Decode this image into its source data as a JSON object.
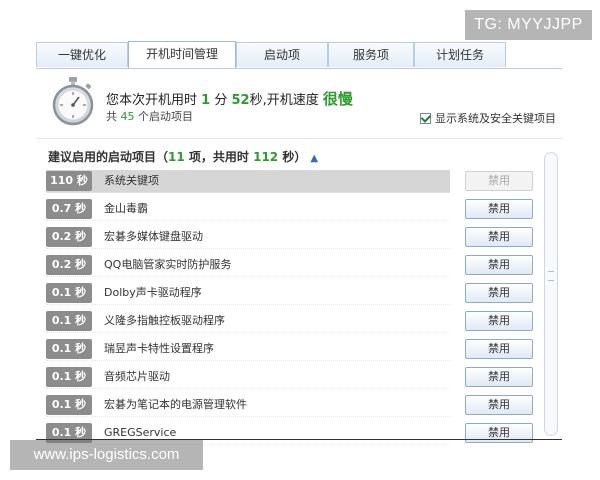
{
  "watermark_top": "TG: MYYJJPP",
  "watermark_bottom": "www.ips-logistics.com",
  "tabs": [
    {
      "label": "一键优化"
    },
    {
      "label": "开机时间管理"
    },
    {
      "label": "启动项"
    },
    {
      "label": "服务项"
    },
    {
      "label": "计划任务"
    }
  ],
  "summary": {
    "prefix": "您本次开机用时",
    "minutes": "1",
    "min_unit": "分",
    "seconds": "52",
    "sec_unit": "秒",
    "speed_label": ",开机速度",
    "speed_value": "很慢",
    "count_prefix": "共",
    "count": "45",
    "count_suffix": "个启动项目"
  },
  "show_system_checkbox": {
    "label": "显示系统及安全关键项目",
    "checked": true
  },
  "section": {
    "prefix": "建议启用的启动项目（",
    "count": "11",
    "middle": "项，共用时",
    "time": "112",
    "suffix": "秒）"
  },
  "items": [
    {
      "time": "110 秒",
      "name": "系统关键项",
      "button": "禁用",
      "disabled": true
    },
    {
      "time": "0.7 秒",
      "name": "金山毒霸",
      "button": "禁用",
      "disabled": false
    },
    {
      "time": "0.2 秒",
      "name": "宏碁多媒体键盘驱动",
      "button": "禁用",
      "disabled": false
    },
    {
      "time": "0.2 秒",
      "name": "QQ电脑管家实时防护服务",
      "button": "禁用",
      "disabled": false
    },
    {
      "time": "0.1 秒",
      "name": "Dolby声卡驱动程序",
      "button": "禁用",
      "disabled": false
    },
    {
      "time": "0.1 秒",
      "name": "义隆多指触控板驱动程序",
      "button": "禁用",
      "disabled": false
    },
    {
      "time": "0.1 秒",
      "name": "瑞昱声卡特性设置程序",
      "button": "禁用",
      "disabled": false
    },
    {
      "time": "0.1 秒",
      "name": "音频芯片驱动",
      "button": "禁用",
      "disabled": false
    },
    {
      "time": "0.1 秒",
      "name": "宏碁为笔记本的电源管理软件",
      "button": "禁用",
      "disabled": false
    },
    {
      "time": "0.1 秒",
      "name": "GREGService",
      "button": "禁用",
      "disabled": false
    }
  ]
}
